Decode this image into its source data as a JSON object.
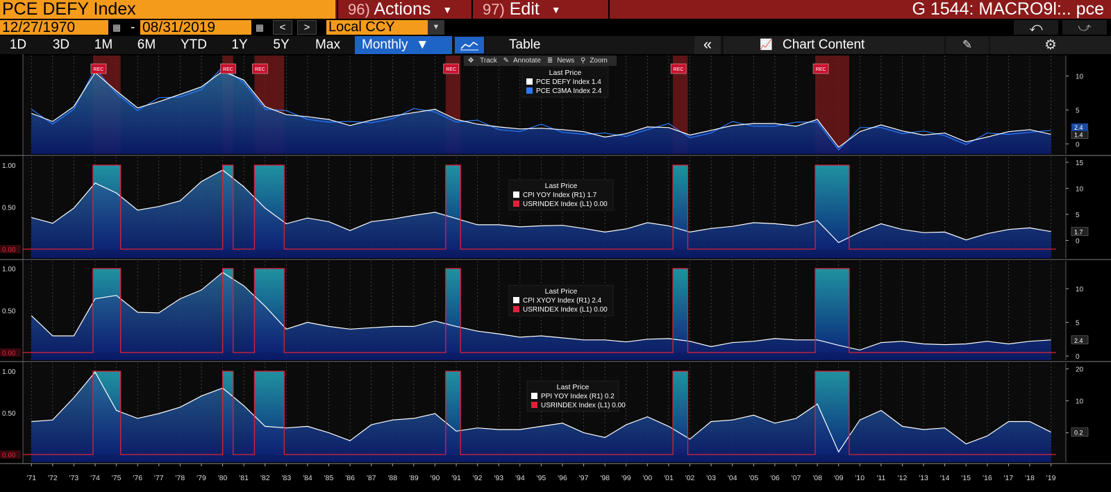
{
  "header": {
    "security": "PCE DEFY Index",
    "actions_num": "96)",
    "actions_label": "Actions",
    "edit_num": "97)",
    "edit_label": "Edit",
    "ticker": "G 1544: MACRO9l:.. pce"
  },
  "controls": {
    "start_date": "12/27/1970",
    "date_sep": "-",
    "end_date": "08/31/2019",
    "currency": "Local CCY",
    "periods": [
      "1D",
      "3D",
      "1M",
      "6M",
      "YTD",
      "1Y",
      "5Y",
      "Max"
    ],
    "frequency": "Monthly",
    "table_label": "Table",
    "chart_content_label": "Chart Content"
  },
  "toolbar": {
    "track": "Track",
    "annotate": "Annotate",
    "news": "News",
    "zoom": "Zoom"
  },
  "colors": {
    "accent_orange": "#f59b1c",
    "header_red": "#8b1a1a",
    "selected_blue": "#1e63c6",
    "recession_red": "#e0203a",
    "teal": "#1a8a9a",
    "navy": "#0a1f6e"
  },
  "chart_data": [
    {
      "type": "line",
      "legend_title": "Last Price",
      "series": [
        {
          "name": "PCE DEFY Index",
          "last": "1.4",
          "color": "#ffffff"
        },
        {
          "name": "PCE C3MA Index",
          "last": "2.4",
          "color": "#2a7bff"
        }
      ],
      "yticks_right": [
        "10",
        "5",
        "0"
      ],
      "ylim": [
        -1.5,
        12.5
      ],
      "x": [
        1971,
        1972,
        1973,
        1974,
        1975,
        1976,
        1977,
        1978,
        1979,
        1980,
        1981,
        1982,
        1983,
        1984,
        1985,
        1986,
        1987,
        1988,
        1989,
        1990,
        1991,
        1992,
        1993,
        1994,
        1995,
        1996,
        1997,
        1998,
        1999,
        2000,
        2001,
        2002,
        2003,
        2004,
        2005,
        2006,
        2007,
        2008,
        2009,
        2010,
        2011,
        2012,
        2013,
        2014,
        2015,
        2016,
        2017,
        2018,
        2019
      ],
      "values": [
        4.5,
        3.3,
        5.5,
        10.5,
        7.8,
        5.3,
        6.2,
        7.3,
        8.4,
        10.7,
        9.4,
        5.5,
        4.3,
        4.0,
        3.6,
        2.7,
        3.5,
        4.1,
        4.6,
        5.1,
        3.6,
        2.9,
        2.5,
        2.2,
        2.3,
        2.1,
        1.8,
        1.0,
        1.5,
        2.5,
        2.4,
        1.3,
        2.0,
        2.7,
        3.0,
        3.0,
        2.6,
        3.6,
        -0.5,
        1.8,
        2.8,
        1.9,
        1.3,
        1.6,
        0.3,
        1.0,
        1.8,
        2.1,
        1.4
      ],
      "recession_labels": "REC"
    },
    {
      "type": "line",
      "legend_title": "Last Price",
      "series": [
        {
          "name": "CPI YOY Index",
          "axis": "(R1)",
          "last": "1.7",
          "color": "#ffffff"
        },
        {
          "name": "USRINDEX Index",
          "axis": "(L1)",
          "last": "0.00",
          "color": "#e0203a"
        }
      ],
      "yticks_left": [
        "1.00",
        "0.50",
        "0.00"
      ],
      "yticks_right": [
        "15",
        "10",
        "5",
        "0"
      ],
      "ylim_right": [
        -3,
        15.5
      ],
      "x": [
        1971,
        1972,
        1973,
        1974,
        1975,
        1976,
        1977,
        1978,
        1979,
        1980,
        1981,
        1982,
        1983,
        1984,
        1985,
        1986,
        1987,
        1988,
        1989,
        1990,
        1991,
        1992,
        1993,
        1994,
        1995,
        1996,
        1997,
        1998,
        1999,
        2000,
        2001,
        2002,
        2003,
        2004,
        2005,
        2006,
        2007,
        2008,
        2009,
        2010,
        2011,
        2012,
        2013,
        2014,
        2015,
        2016,
        2017,
        2018,
        2019
      ],
      "values": [
        4.4,
        3.3,
        6.2,
        11.0,
        9.1,
        5.8,
        6.5,
        7.6,
        11.3,
        13.5,
        10.3,
        6.2,
        3.2,
        4.3,
        3.6,
        1.9,
        3.6,
        4.1,
        4.8,
        5.4,
        4.2,
        3.0,
        3.0,
        2.6,
        2.8,
        2.9,
        2.3,
        1.6,
        2.2,
        3.4,
        2.8,
        1.6,
        2.3,
        2.7,
        3.4,
        3.2,
        2.8,
        3.8,
        -0.4,
        1.6,
        3.2,
        2.1,
        1.5,
        1.6,
        0.1,
        1.3,
        2.1,
        2.4,
        1.7
      ]
    },
    {
      "type": "line",
      "legend_title": "Last Price",
      "series": [
        {
          "name": "CPI XYOY Index",
          "axis": "(R1)",
          "last": "2.4",
          "color": "#ffffff"
        },
        {
          "name": "USRINDEX Index",
          "axis": "(L1)",
          "last": "0.00",
          "color": "#e0203a"
        }
      ],
      "yticks_left": [
        "1.00",
        "0.50",
        "0.00"
      ],
      "yticks_right": [
        "10",
        "5",
        "0"
      ],
      "ylim_right": [
        -0.5,
        13.8
      ],
      "x": [
        1971,
        1972,
        1973,
        1974,
        1975,
        1976,
        1977,
        1978,
        1979,
        1980,
        1981,
        1982,
        1983,
        1984,
        1985,
        1986,
        1987,
        1988,
        1989,
        1990,
        1991,
        1992,
        1993,
        1994,
        1995,
        1996,
        1997,
        1998,
        1999,
        2000,
        2001,
        2002,
        2003,
        2004,
        2005,
        2006,
        2007,
        2008,
        2009,
        2010,
        2011,
        2012,
        2013,
        2014,
        2015,
        2016,
        2017,
        2018,
        2019
      ],
      "values": [
        6.0,
        3.0,
        3.0,
        8.5,
        9.0,
        6.5,
        6.4,
        8.5,
        9.8,
        12.4,
        10.4,
        7.4,
        4.0,
        5.0,
        4.4,
        4.0,
        4.2,
        4.4,
        4.4,
        5.2,
        4.4,
        3.7,
        3.3,
        2.8,
        3.0,
        2.7,
        2.4,
        2.4,
        2.1,
        2.5,
        2.6,
        2.2,
        1.4,
        2.0,
        2.2,
        2.6,
        2.4,
        2.4,
        1.6,
        0.9,
        2.0,
        2.2,
        1.8,
        1.7,
        1.8,
        2.2,
        1.8,
        2.2,
        2.4
      ]
    },
    {
      "type": "line",
      "legend_title": "Last Price",
      "series": [
        {
          "name": "PPI YOY Index",
          "axis": "(R1)",
          "last": "0.2",
          "color": "#ffffff"
        },
        {
          "name": "USRINDEX Index",
          "axis": "(L1)",
          "last": "0.00",
          "color": "#e0203a"
        }
      ],
      "yticks_left": [
        "1.00",
        "0.50",
        "0.00"
      ],
      "yticks_right": [
        "20",
        "10",
        "0"
      ],
      "ylim_right": [
        -9,
        21
      ],
      "x": [
        1971,
        1972,
        1973,
        1974,
        1975,
        1976,
        1977,
        1978,
        1979,
        1980,
        1981,
        1982,
        1983,
        1984,
        1985,
        1986,
        1987,
        1988,
        1989,
        1990,
        1991,
        1992,
        1993,
        1994,
        1995,
        1996,
        1997,
        1998,
        1999,
        2000,
        2001,
        2002,
        2003,
        2004,
        2005,
        2006,
        2007,
        2008,
        2009,
        2010,
        2011,
        2012,
        2013,
        2014,
        2015,
        2016,
        2017,
        2018,
        2019
      ],
      "values": [
        3.5,
        4.0,
        11.0,
        19.0,
        7.0,
        4.5,
        6.0,
        8.0,
        11.5,
        14.0,
        8.5,
        2.0,
        1.5,
        2.0,
        0.0,
        -2.5,
        2.5,
        4.0,
        4.5,
        6.0,
        0.5,
        1.5,
        1.0,
        1.0,
        2.0,
        3.0,
        0.0,
        -1.5,
        2.5,
        5.0,
        2.0,
        -2.0,
        3.5,
        4.0,
        5.5,
        3.0,
        4.5,
        9.0,
        -6.0,
        4.0,
        7.0,
        2.0,
        1.0,
        1.5,
        -3.5,
        -1.0,
        3.5,
        3.5,
        0.2
      ]
    }
  ],
  "recessions": [
    [
      1973.9,
      1975.2
    ],
    [
      1980.0,
      1980.5
    ],
    [
      1981.5,
      1982.9
    ],
    [
      1990.5,
      1991.2
    ],
    [
      2001.2,
      2001.9
    ],
    [
      2007.9,
      2009.5
    ]
  ],
  "x_axis_labels": [
    "'71",
    "'72",
    "'73",
    "'74",
    "'75",
    "'76",
    "'77",
    "'78",
    "'79",
    "'80",
    "'81",
    "'82",
    "'83",
    "'84",
    "'85",
    "'86",
    "'87",
    "'88",
    "'89",
    "'90",
    "'91",
    "'92",
    "'93",
    "'94",
    "'95",
    "'96",
    "'97",
    "'98",
    "'99",
    "'00",
    "'01",
    "'02",
    "'03",
    "'04",
    "'05",
    "'06",
    "'07",
    "'08",
    "'09",
    "'10",
    "'11",
    "'12",
    "'13",
    "'14",
    "'15",
    "'16",
    "'17",
    "'18",
    "'19"
  ]
}
